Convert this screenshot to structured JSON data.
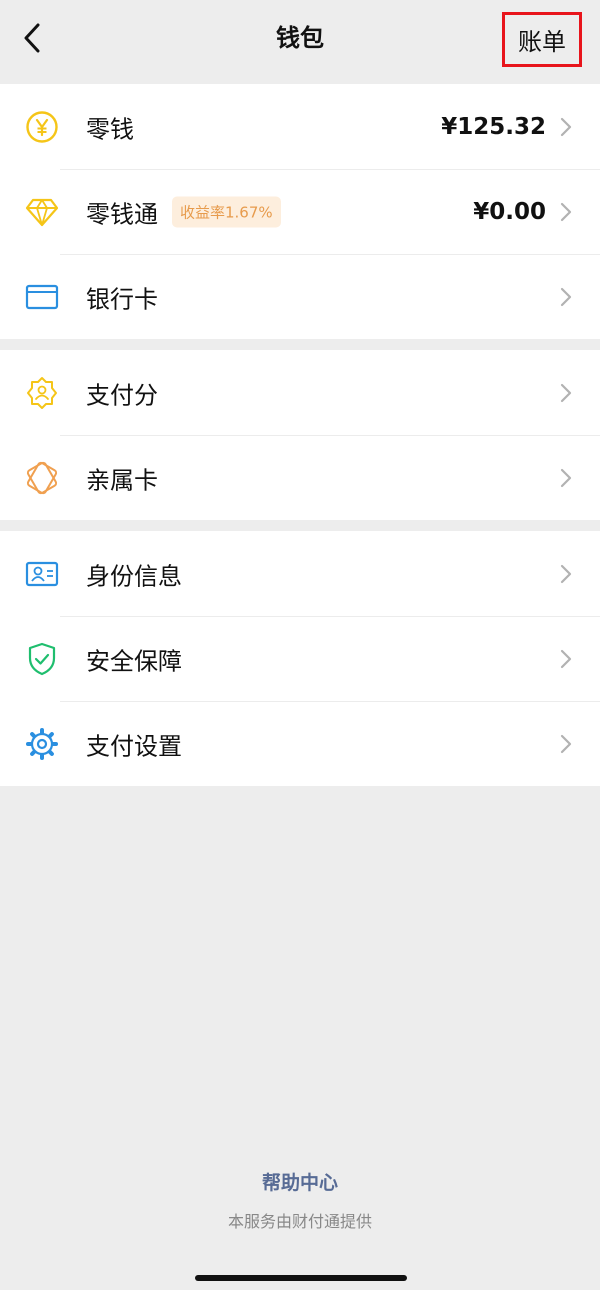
{
  "header": {
    "title": "钱包",
    "bill_label": "账单"
  },
  "groups": [
    {
      "items": [
        {
          "label": "零钱",
          "value": "¥125.32",
          "icon": "yen-coin-icon"
        },
        {
          "label": "零钱通",
          "badge": "收益率1.67%",
          "value": "¥0.00",
          "icon": "diamond-icon"
        },
        {
          "label": "银行卡",
          "icon": "bank-card-icon"
        }
      ]
    },
    {
      "items": [
        {
          "label": "支付分",
          "icon": "pay-score-icon"
        },
        {
          "label": "亲属卡",
          "icon": "family-card-icon"
        }
      ]
    },
    {
      "items": [
        {
          "label": "身份信息",
          "icon": "id-card-icon"
        },
        {
          "label": "安全保障",
          "icon": "shield-check-icon"
        },
        {
          "label": "支付设置",
          "icon": "gear-icon"
        }
      ]
    }
  ],
  "footer": {
    "help_center": "帮助中心",
    "provider_note": "本服务由财付通提供"
  },
  "colors": {
    "background": "#ededed",
    "card": "#ffffff",
    "yellow": "#f5c518",
    "blue": "#2a8fe0",
    "orange": "#f0a050",
    "green": "#1fbe6e",
    "link": "#576b95",
    "highlight_border": "#e8141b"
  }
}
